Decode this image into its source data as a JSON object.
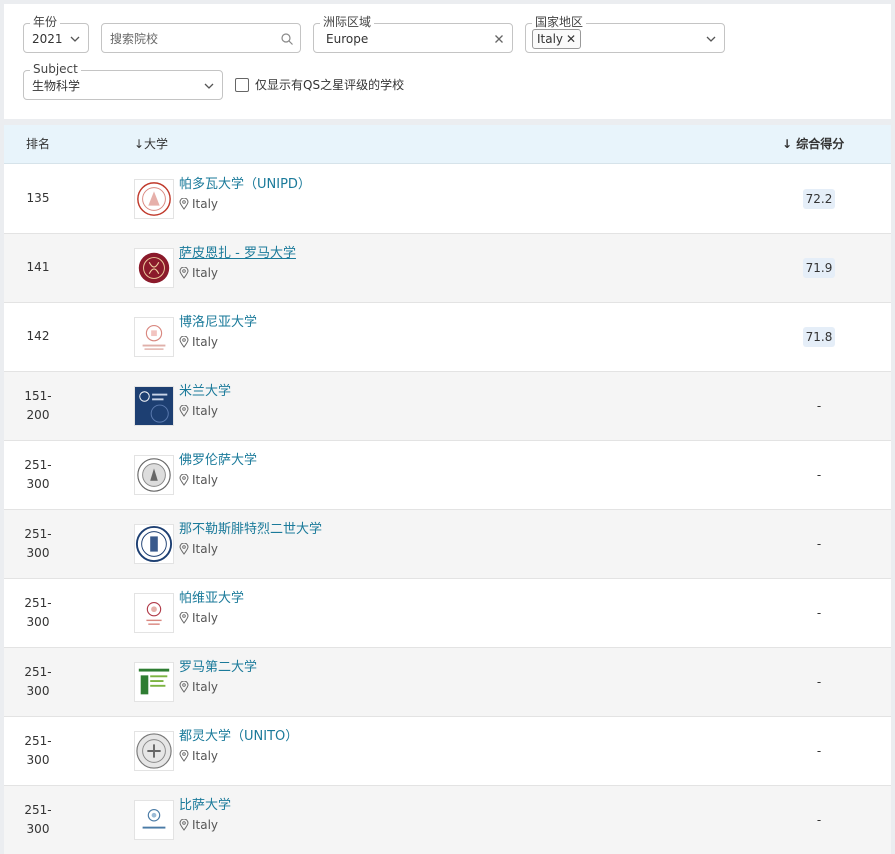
{
  "filters": {
    "year": {
      "label": "年份",
      "value": "2021"
    },
    "search": {
      "placeholder": "搜索院校"
    },
    "region": {
      "label": "洲际区域",
      "value": "Europe"
    },
    "country": {
      "label": "国家地区",
      "chip": "Italy"
    },
    "subject": {
      "label": "Subject",
      "value": "生物科学"
    },
    "qs_stars": {
      "label": "仅显示有QS之星评级的学校",
      "checked": false
    }
  },
  "table": {
    "headers": {
      "rank": "排名",
      "university": "↓大学",
      "score": "综合得分"
    },
    "rows": [
      {
        "rank": "135",
        "name": "帕多瓦大学（UNIPD）",
        "location": "Italy",
        "score": "72.2",
        "logo": "padova-seal"
      },
      {
        "rank": "141",
        "name": "萨皮恩扎 - 罗马大学",
        "location": "Italy",
        "score": "71.9",
        "logo": "sapienza-seal"
      },
      {
        "rank": "142",
        "name": "博洛尼亚大学",
        "location": "Italy",
        "score": "71.8",
        "logo": "bologna-seal"
      },
      {
        "rank": "151-\n200",
        "name": "米兰大学",
        "location": "Italy",
        "score": "-",
        "logo": "milano-logo"
      },
      {
        "rank": "251-\n300",
        "name": "佛罗伦萨大学",
        "location": "Italy",
        "score": "-",
        "logo": "firenze-seal"
      },
      {
        "rank": "251-\n300",
        "name": "那不勒斯腓特烈二世大学",
        "location": "Italy",
        "score": "-",
        "logo": "napoli-seal"
      },
      {
        "rank": "251-\n300",
        "name": "帕维亚大学",
        "location": "Italy",
        "score": "-",
        "logo": "pavia-seal"
      },
      {
        "rank": "251-\n300",
        "name": "罗马第二大学",
        "location": "Italy",
        "score": "-",
        "logo": "tor-vergata-logo"
      },
      {
        "rank": "251-\n300",
        "name": "都灵大学（UNITO）",
        "location": "Italy",
        "score": "-",
        "logo": "torino-seal"
      },
      {
        "rank": "251-\n300",
        "name": "比萨大学",
        "location": "Italy",
        "score": "-",
        "logo": "pisa-logo"
      }
    ]
  },
  "colors": {
    "link": "#1a7a9a",
    "header_bg": "#e8f4fb",
    "score_pill": "#e5eef8"
  }
}
